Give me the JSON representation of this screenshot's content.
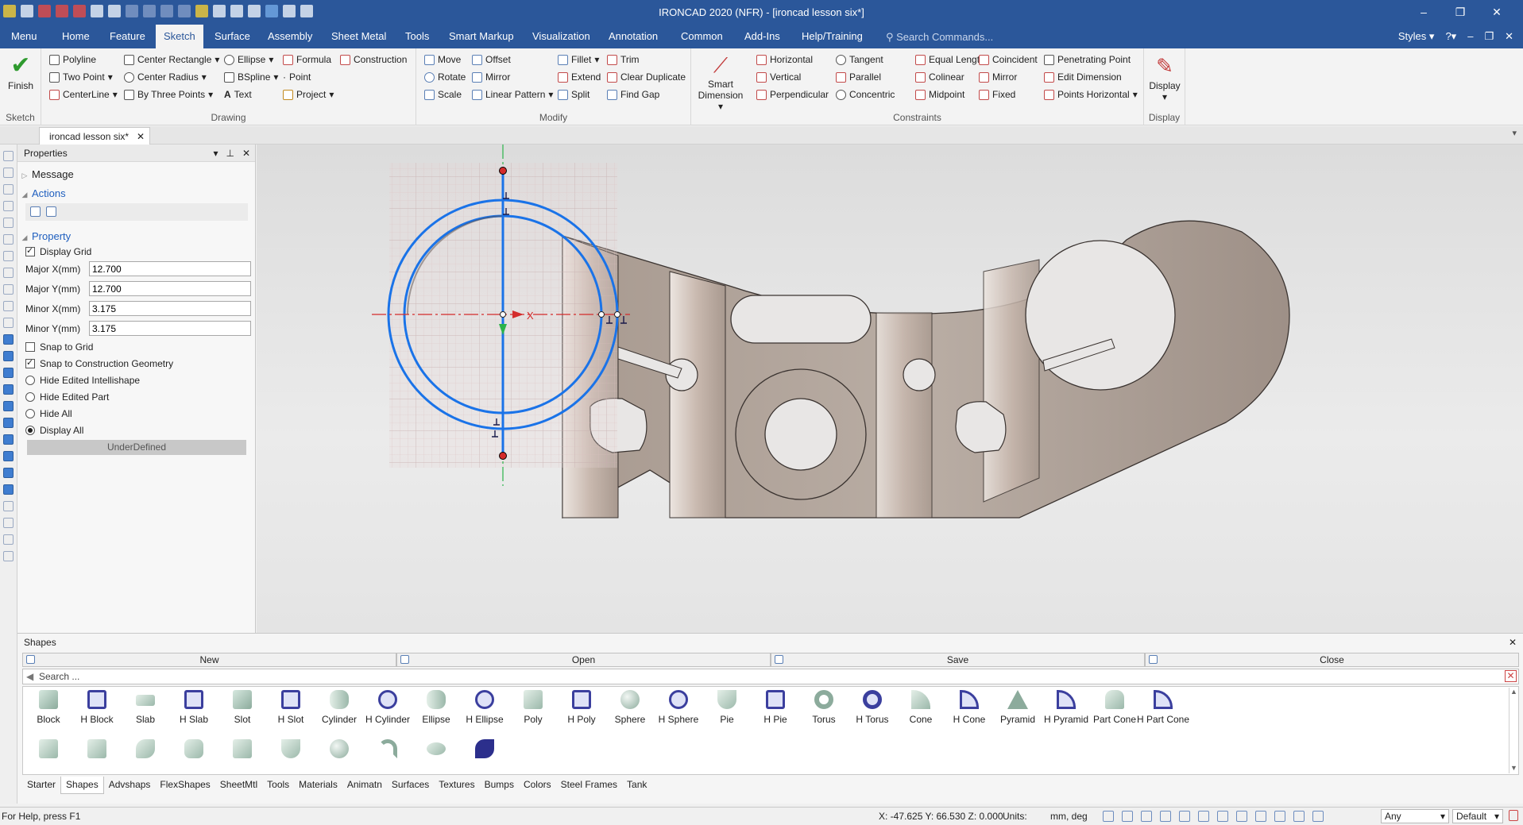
{
  "titlebar": {
    "title": "IRONCAD 2020 (NFR) - [ironcad lesson six*]",
    "minimize": "–",
    "restore": "❐",
    "close": "✕"
  },
  "ribbon_tabs": [
    "Menu",
    "Home",
    "Feature",
    "Sketch",
    "Surface",
    "Assembly",
    "Sheet Metal",
    "Tools",
    "Smart Markup",
    "Visualization",
    "Annotation",
    "Common",
    "Add-Ins",
    "Help/Training"
  ],
  "active_tab": "Sketch",
  "search_commands": "Search Commands...",
  "styles_label": "Styles",
  "ribbon": {
    "sketch": {
      "finish": "Finish",
      "label": "Sketch"
    },
    "drawing": {
      "label": "Drawing",
      "items": [
        "Polyline",
        "Center Rectangle",
        "Ellipse",
        "Formula",
        "Construction",
        "Two Point",
        "Center Radius",
        "BSpline",
        "Point",
        "CenterLine",
        "By Three Points",
        "Text",
        "Project"
      ]
    },
    "modify": {
      "label": "Modify",
      "items": [
        "Move",
        "Offset",
        "Fillet",
        "Trim",
        "Rotate",
        "Mirror",
        "Extend",
        "Clear Duplicate",
        "Scale",
        "Linear Pattern",
        "Split",
        "Find Gap"
      ]
    },
    "constraints": {
      "label": "Constraints",
      "smart_dimension_1": "Smart",
      "smart_dimension_2": "Dimension",
      "items": [
        "Horizontal",
        "Tangent",
        "Equal Length",
        "Coincident",
        "Penetrating Point",
        "Vertical",
        "Parallel",
        "Colinear",
        "Mirror",
        "Edit Dimension",
        "Perpendicular",
        "Concentric",
        "Midpoint",
        "Fixed",
        "Points Horizontal"
      ]
    },
    "display": {
      "button": "Display",
      "label": "Display"
    }
  },
  "document_tab": {
    "name": "ironcad lesson six*",
    "close": "✕"
  },
  "properties": {
    "title": "Properties",
    "message": "Message",
    "actions": "Actions",
    "property": "Property",
    "display_grid": "Display Grid",
    "major_x_label": "Major X(mm)",
    "major_x": "12.700",
    "major_y_label": "Major Y(mm)",
    "major_y": "12.700",
    "minor_x_label": "Minor X(mm)",
    "minor_x": "3.175",
    "minor_y_label": "Minor Y(mm)",
    "minor_y": "3.175",
    "snap_to_grid": "Snap to Grid",
    "snap_to_construction": "Snap to Construction Geometry",
    "hide_edited_intellishape": "Hide Edited Intellishape",
    "hide_edited_part": "Hide Edited Part",
    "hide_all": "Hide All",
    "display_all": "Display All",
    "status": "UnderDefined"
  },
  "viewport": {
    "axis_label": "X"
  },
  "shapes_panel": {
    "title": "Shapes",
    "new": "New",
    "open": "Open",
    "save": "Save",
    "close": "Close",
    "search_placeholder": "Search ...",
    "items": [
      "Block",
      "H Block",
      "Slab",
      "H Slab",
      "Slot",
      "H Slot",
      "Cylinder",
      "H Cylinder",
      "Ellipse",
      "H Ellipse",
      "Poly",
      "H Poly",
      "Sphere",
      "H Sphere",
      "Pie",
      "H Pie",
      "Torus",
      "H Torus",
      "Cone",
      "H Cone",
      "Pyramid",
      "H Pyramid",
      "Part Cone",
      "H Part Cone"
    ],
    "categories": [
      "Starter",
      "Shapes",
      "Advshaps",
      "FlexShapes",
      "SheetMtl",
      "Tools",
      "Materials",
      "Animatn",
      "Surfaces",
      "Textures",
      "Bumps",
      "Colors",
      "Steel Frames",
      "Tank"
    ],
    "active_category": "Shapes"
  },
  "statusbar": {
    "help": "For Help, press F1",
    "coords": "X: -47.625 Y: 66.530 Z: 0.000",
    "units_label": "Units:",
    "units_value": "mm, deg",
    "filter": "Any",
    "style": "Default"
  }
}
